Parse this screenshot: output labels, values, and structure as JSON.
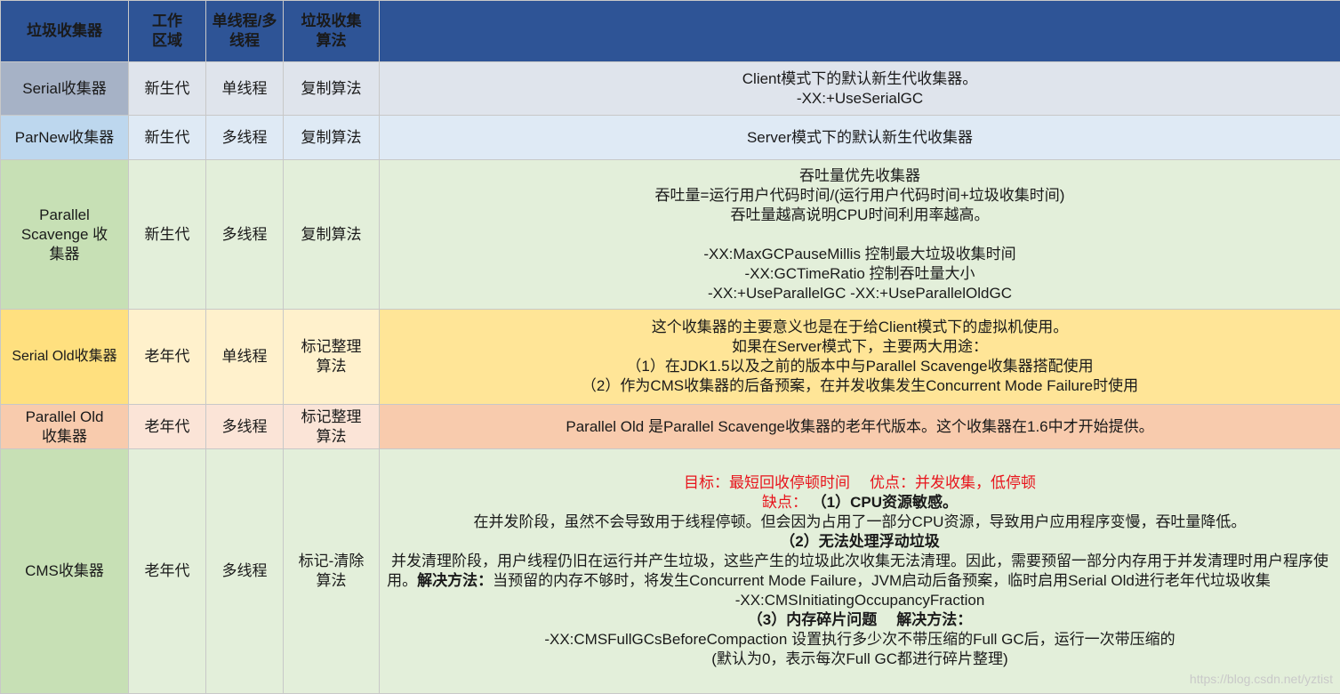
{
  "header": {
    "col1": "垃圾收集器",
    "col2": "工作区域",
    "col3": "单线程/多线程",
    "col4": "垃圾收集算法",
    "col5": ""
  },
  "rows": {
    "serial": {
      "name": "Serial收集器",
      "area": "新生代",
      "thread": "单线程",
      "algo": "复制算法",
      "desc": [
        "Client模式下的默认新生代收集器。",
        "-XX:+UseSerialGC"
      ]
    },
    "parnew": {
      "name": "ParNew收集器",
      "area": "新生代",
      "thread": "多线程",
      "algo": "复制算法",
      "desc": [
        "Server模式下的默认新生代收集器"
      ]
    },
    "scavenge": {
      "name": "Parallel Scavenge 收集器",
      "area": "新生代",
      "thread": "多线程",
      "algo": "复制算法",
      "desc": [
        "吞吐量优先收集器",
        "吞吐量=运行用户代码时间/(运行用户代码时间+垃圾收集时间)",
        "吞吐量越高说明CPU时间利用率越高。",
        "-XX:MaxGCPauseMillis 控制最大垃圾收集时间",
        "-XX:GCTimeRatio 控制吞吐量大小",
        "-XX:+UseParallelGC -XX:+UseParallelOldGC"
      ]
    },
    "serial_old": {
      "name": "Serial Old收集器",
      "area": "老年代",
      "thread": "单线程",
      "algo": "标记整理算法",
      "desc": [
        "这个收集器的主要意义也是在于给Client模式下的虚拟机使用。",
        "如果在Server模式下，主要两大用途：",
        "（1）在JDK1.5以及之前的版本中与Parallel Scavenge收集器搭配使用",
        "（2）作为CMS收集器的后备预案，在并发收集发生Concurrent Mode Failure时使用"
      ]
    },
    "parallel_old": {
      "name": "Parallel Old 收集器",
      "area": "老年代",
      "thread": "多线程",
      "algo": "标记整理算法",
      "desc": [
        "Parallel Old 是Parallel Scavenge收集器的老年代版本。这个收集器在1.6中才开始提供。"
      ]
    },
    "cms": {
      "name": "CMS收集器",
      "area": "老年代",
      "thread": "多线程",
      "algo": "标记-清除算法",
      "goal": "目标：最短回收停顿时间",
      "advantage": "优点：并发收集，低停顿",
      "drawback_label": "缺点：",
      "p1_title": "（1）CPU资源敏感。",
      "p1_text": "在并发阶段，虽然不会导致用于线程停顿。但会因为占用了一部分CPU资源，导致用户应用程序变慢，吞吐量降低。",
      "p2_title": "（2）无法处理浮动垃圾",
      "p2_text_a": "并发清理阶段，用户线程仍旧在运行并产生垃圾，这些产生的垃圾此次收集无法清理。因此，需要预留一部分内存用于并发清理时用户程序使用。",
      "p2_solution_label": "解决方法：",
      "p2_text_b": "当预留的内存不够时，将发生Concurrent Mode Failure，JVM启动后备预案，临时启用Serial Old进行老年代垃圾收集",
      "p2_flag": "-XX:CMSInitiatingOccupancyFraction",
      "p3_title": "（3）内存碎片问题",
      "p3_solution_label": "解决方法：",
      "p3_text": "-XX:CMSFullGCsBeforeCompaction 设置执行多少次不带压缩的Full GC后，运行一次带压缩的",
      "p3_note": "(默认为0，表示每次Full GC都进行碎片整理)"
    }
  },
  "watermark": "https://blog.csdn.net/yztist"
}
